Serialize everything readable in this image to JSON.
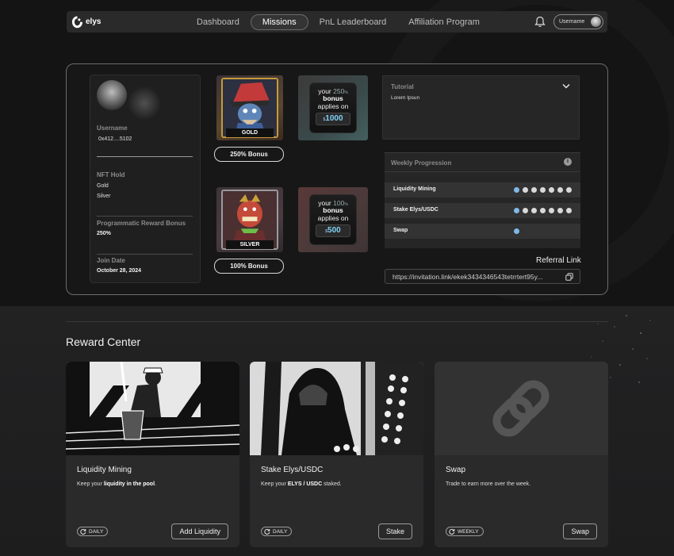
{
  "nav": {
    "logo_text": "elys",
    "links": [
      "Dashboard",
      "Missions",
      "PnL Leaderboard",
      "Affiliation Program"
    ],
    "active_index": 1,
    "username": "Username"
  },
  "profile": {
    "username_label": "Username",
    "address": "0x412....5102",
    "nft_hold_label": "NFT Hold",
    "nfts": [
      "Gold",
      "Silver"
    ],
    "reward_bonus_label": "Programmatic Reward Bonus",
    "reward_bonus_value": "250%",
    "join_date_label": "Join Date",
    "join_date_value": "October 28, 2024"
  },
  "nft_cards": [
    {
      "name": "GOLD",
      "bonus_button": "250% Bonus",
      "tile": {
        "l1": "your",
        "pct": "250",
        "pct_suffix": "%",
        "l2": "bonus",
        "l3": "applies on",
        "currency": "$",
        "amount": "1000"
      }
    },
    {
      "name": "SILVER",
      "bonus_button": "100% Bonus",
      "tile": {
        "l1": "your",
        "pct": "100",
        "pct_suffix": "%",
        "l2": "bonus",
        "l3": "applies on",
        "currency": "$",
        "amount": "500"
      }
    }
  ],
  "tutorial": {
    "title": "Tutorial",
    "text": "Lorem Ipsun"
  },
  "weekly": {
    "title": "Weekly Progression",
    "info": "i",
    "rows": [
      {
        "label": "Liquidity Mining",
        "completed": 1,
        "total": 7
      },
      {
        "label": "Stake Elys/USDC",
        "completed": 1,
        "total": 7
      },
      {
        "label": "Swap",
        "completed": 1,
        "total": 1
      }
    ]
  },
  "referral": {
    "label": "Referral Link",
    "link": "https://invitation.link/ekek3434346543tetrrtert95y..."
  },
  "reward_center": {
    "title": "Reward Center",
    "cards": [
      {
        "title": "Liquidity Mining",
        "desc_pre": "Keep your ",
        "desc_bold": "liquidity in the pool",
        "desc_post": ".",
        "frequency": "DAILY",
        "button": "Add Liquidity"
      },
      {
        "title": "Stake Elys/USDC",
        "desc_pre": "Keep your ",
        "desc_bold": "ELYS / USDC",
        "desc_post": " staked.",
        "frequency": "DAILY",
        "button": "Stake"
      },
      {
        "title": "Swap",
        "desc_pre": "Trade to earn more over the week.",
        "desc_bold": "",
        "desc_post": "",
        "frequency": "WEEKLY",
        "button": "Swap"
      }
    ]
  },
  "colors": {
    "accent_blue": "#7fb8e6",
    "amount_blue": "#7fd0f2",
    "gold_frame": "#c59a3a"
  }
}
